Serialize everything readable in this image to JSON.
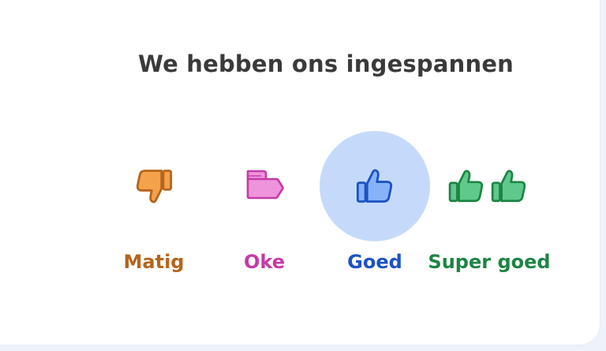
{
  "question": "We hebben ons ingespannen",
  "colors": {
    "matig": "#b6651c",
    "oke": "#c53aa6",
    "goed": "#1d52c4",
    "super_goed": "#1e8444",
    "selected_circle": "#c5dafb"
  },
  "options": [
    {
      "label": "Matig",
      "icon": "thumbs-down-icon",
      "selected": false
    },
    {
      "label": "Oke",
      "icon": "thumbs-sideways-icon",
      "selected": false
    },
    {
      "label": "Goed",
      "icon": "thumbs-up-icon",
      "selected": true
    },
    {
      "label": "Super goed",
      "icon": "double-thumbs-up-icon",
      "selected": false
    }
  ]
}
